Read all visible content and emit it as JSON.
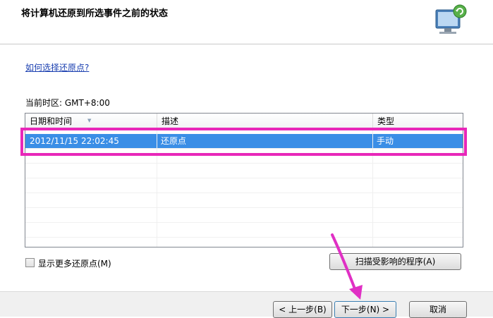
{
  "header": {
    "title": "将计算机还原到所选事件之前的状态",
    "icon": "system-restore-monitor-icon"
  },
  "help_link": "如何选择还原点?",
  "timezone_label": "当前时区: GMT+8:00",
  "table": {
    "columns": [
      "日期和时间",
      "描述",
      "类型"
    ],
    "rows": [
      {
        "date": "2012/11/15 22:02:45",
        "desc": "还原点",
        "type": "手动",
        "selected": true
      }
    ]
  },
  "show_more": {
    "label": "显示更多还原点(M)",
    "checked": false
  },
  "buttons": {
    "scan": "扫描受影响的程序(A)",
    "back": "< 上一步(B)",
    "next": "下一步(N) >",
    "cancel": "取消"
  },
  "colors": {
    "selection": "#3a8ee6",
    "highlight_box": "#e827b9",
    "annotation_arrow": "#e030c4"
  }
}
